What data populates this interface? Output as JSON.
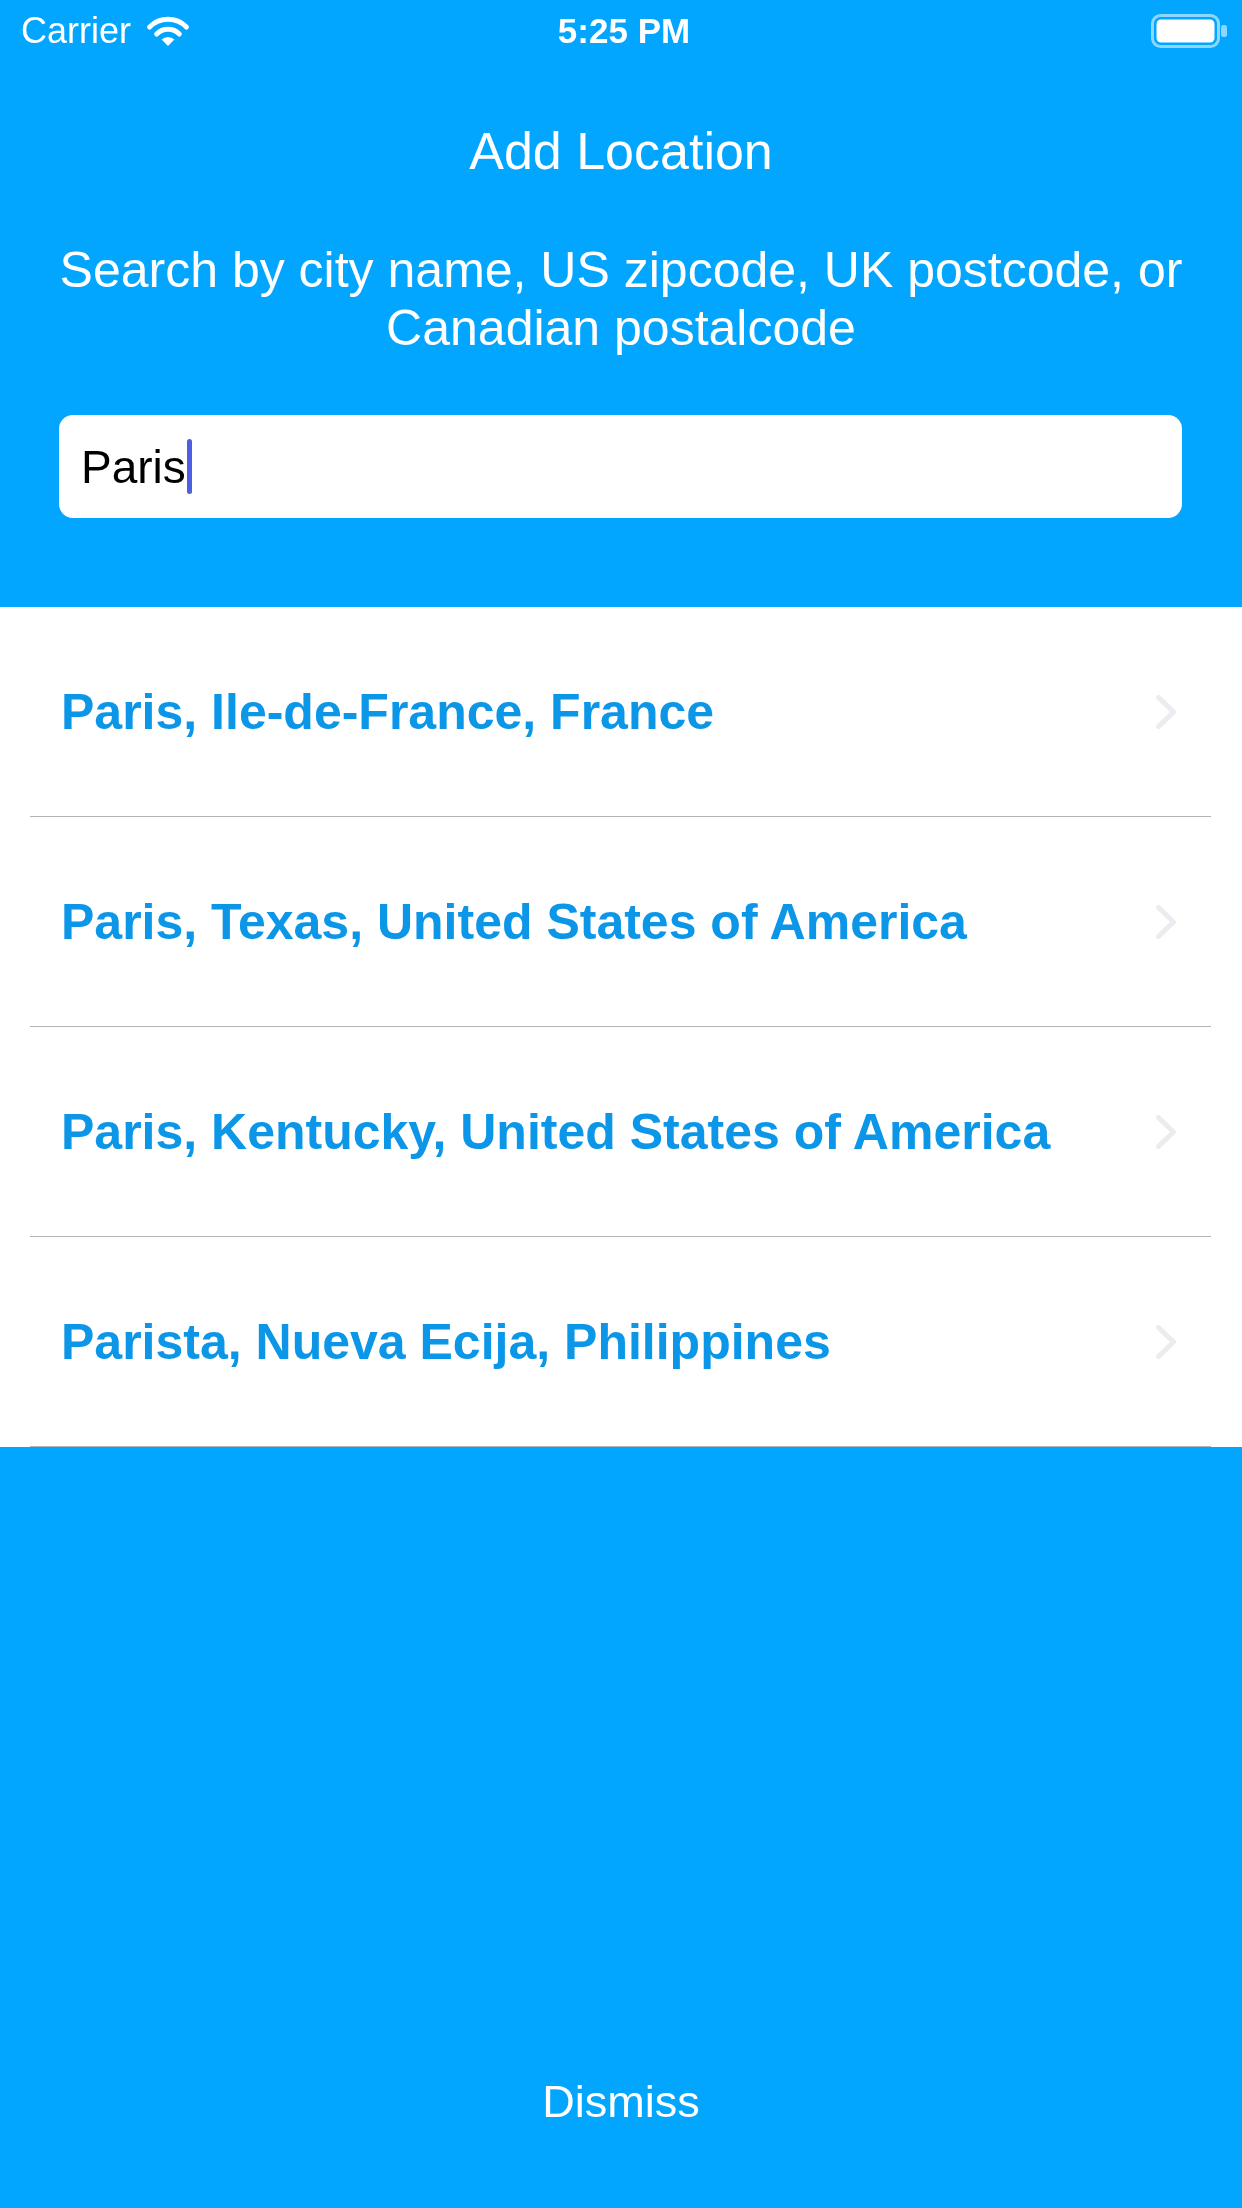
{
  "status_bar": {
    "carrier": "Carrier",
    "time": "5:25 PM"
  },
  "header": {
    "title": "Add Location",
    "subtitle": "Search by city name, US zipcode, UK postcode, or Canadian postalcode"
  },
  "search": {
    "value": "Paris",
    "focused": true
  },
  "results": [
    {
      "label": "Paris, Ile-de-France, France"
    },
    {
      "label": "Paris, Texas, United States of America"
    },
    {
      "label": "Paris, Kentucky, United States of America"
    },
    {
      "label": "Parista, Nueva Ecija, Philippines"
    }
  ],
  "dismiss_button": {
    "label": "Dismiss"
  }
}
